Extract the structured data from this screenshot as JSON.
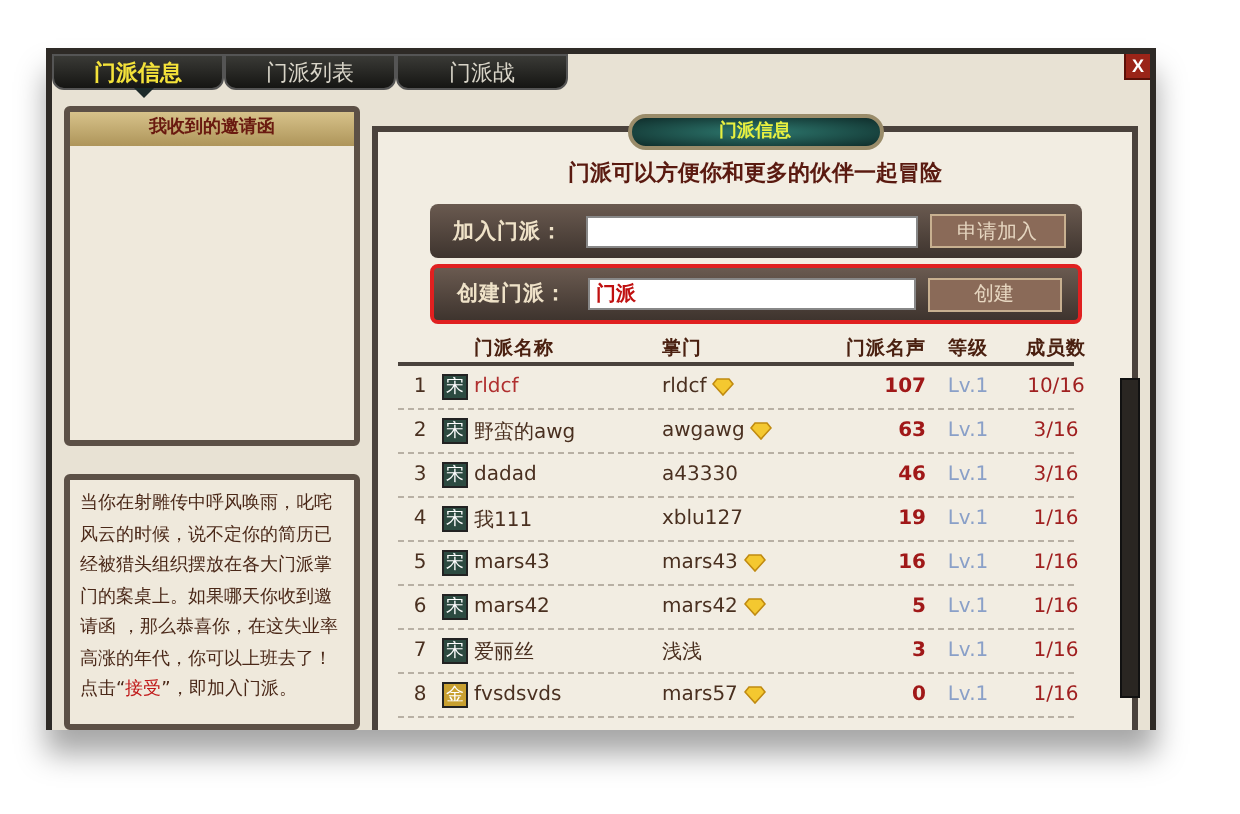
{
  "tabs": [
    {
      "label": "门派信息",
      "selected": true
    },
    {
      "label": "门派列表",
      "selected": false
    },
    {
      "label": "门派战",
      "selected": false
    }
  ],
  "close_button": {
    "label": "X"
  },
  "invitations": {
    "title": "我收到的邀请函"
  },
  "notice": {
    "text": "当你在射雕传中呼风唤雨，叱咤风云的时候，说不定你的简历已经被猎头组织摆放在各大门派掌门的案桌上。如果哪天你收到邀请函 ，那么恭喜你，在这失业率高涨的年代，你可以上班去了！点击“",
    "link": "接受",
    "after": "”，即加入门派。"
  },
  "panel": {
    "badge": "门派信息",
    "tagline": "门派可以方便你和更多的伙伴一起冒险"
  },
  "join": {
    "label": "加入门派：",
    "button": "申请加入",
    "highlighted": false
  },
  "create": {
    "label": "创建门派：",
    "value": "门派",
    "button": "创建",
    "highlighted": true
  },
  "table": {
    "columns": [
      "门派名称",
      "掌门",
      "门派名声",
      "等级",
      "成员数"
    ],
    "rows": [
      {
        "rank": "1",
        "emblem": "宋",
        "color": "#2c4a40",
        "name": "rldcf",
        "selected": true,
        "leader": "rldcf",
        "vip": true,
        "reputation": "107",
        "level": "Lv.1",
        "members": "10/16"
      },
      {
        "rank": "2",
        "emblem": "宋",
        "color": "#2c4a40",
        "name": "野蛮的awg",
        "selected": false,
        "leader": "awgawg",
        "vip": true,
        "reputation": "63",
        "level": "Lv.1",
        "members": "3/16"
      },
      {
        "rank": "3",
        "emblem": "宋",
        "color": "#2c4a40",
        "name": "dadad",
        "selected": false,
        "leader": "a43330",
        "vip": false,
        "reputation": "46",
        "level": "Lv.1",
        "members": "3/16"
      },
      {
        "rank": "4",
        "emblem": "宋",
        "color": "#2c4a40",
        "name": "我111",
        "selected": false,
        "leader": "xblu127",
        "vip": false,
        "reputation": "19",
        "level": "Lv.1",
        "members": "1/16"
      },
      {
        "rank": "5",
        "emblem": "宋",
        "color": "#2c4a40",
        "name": "mars43",
        "selected": false,
        "leader": "mars43",
        "vip": true,
        "reputation": "16",
        "level": "Lv.1",
        "members": "1/16"
      },
      {
        "rank": "6",
        "emblem": "宋",
        "color": "#2c4a40",
        "name": "mars42",
        "selected": false,
        "leader": "mars42",
        "vip": true,
        "reputation": "5",
        "level": "Lv.1",
        "members": "1/16"
      },
      {
        "rank": "7",
        "emblem": "宋",
        "color": "#2c4a40",
        "name": "爱丽丝",
        "selected": false,
        "leader": "浅浅",
        "vip": false,
        "reputation": "3",
        "level": "Lv.1",
        "members": "1/16"
      },
      {
        "rank": "8",
        "emblem": "金",
        "color": "#c8a030",
        "name": "fvsdsvds",
        "selected": false,
        "leader": "mars57",
        "vip": true,
        "reputation": "0",
        "level": "Lv.1",
        "members": "1/16"
      }
    ]
  }
}
